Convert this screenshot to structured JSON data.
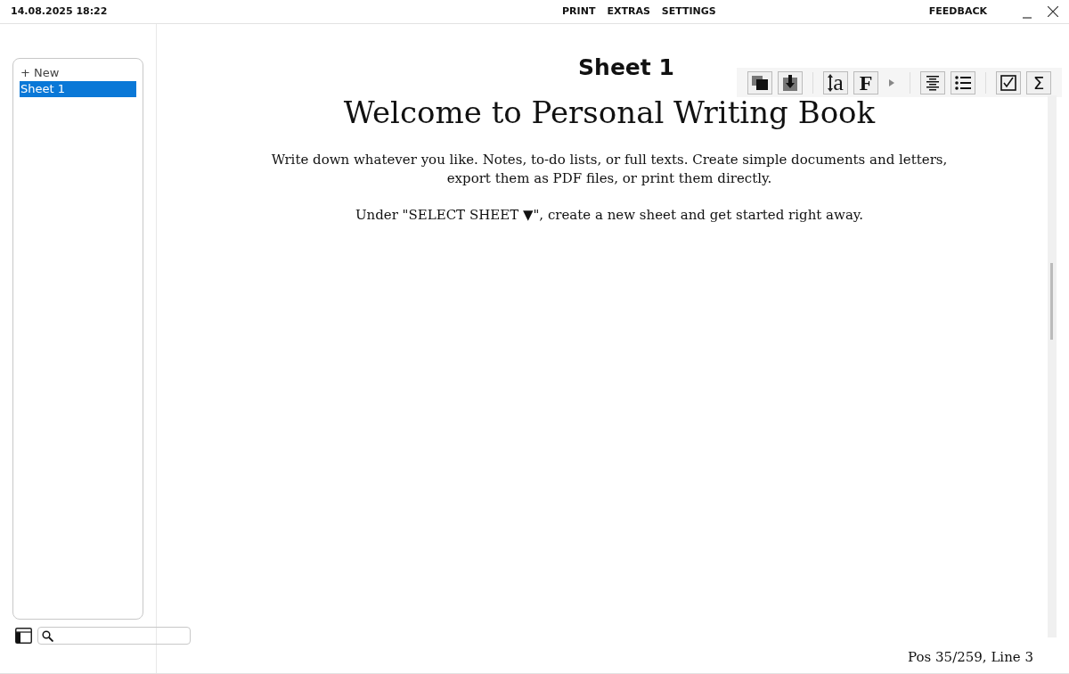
{
  "title_bar": {
    "datetime": "14.08.2025 18:22",
    "menu": [
      "PRINT",
      "EXTRAS",
      "SETTINGS"
    ],
    "feedback": "FEEDBACK"
  },
  "sidebar": {
    "items": [
      {
        "label": "+ New",
        "selected": false
      },
      {
        "label": "Sheet 1",
        "selected": true
      }
    ]
  },
  "sheet": {
    "title": "Sheet 1",
    "heading": "Welcome to Personal Writing Book",
    "paragraphs": [
      "Write down whatever you like. Notes, to-do lists, or full texts. Create simple documents and letters, export them as PDF files, or print them directly.",
      "Under \"SELECT SHEET ▼\", create a new sheet and get started right away."
    ]
  },
  "toolbar": [
    {
      "kind": "copy"
    },
    {
      "kind": "download"
    },
    {
      "kind": "sep"
    },
    {
      "kind": "size",
      "glyph": "a"
    },
    {
      "kind": "font",
      "glyph": "F"
    },
    {
      "kind": "caret"
    },
    {
      "kind": "sep"
    },
    {
      "kind": "align"
    },
    {
      "kind": "list"
    },
    {
      "kind": "sep"
    },
    {
      "kind": "check"
    },
    {
      "kind": "glyph",
      "glyph": "Σ"
    }
  ],
  "status": "Pos 35/259, Line 3"
}
